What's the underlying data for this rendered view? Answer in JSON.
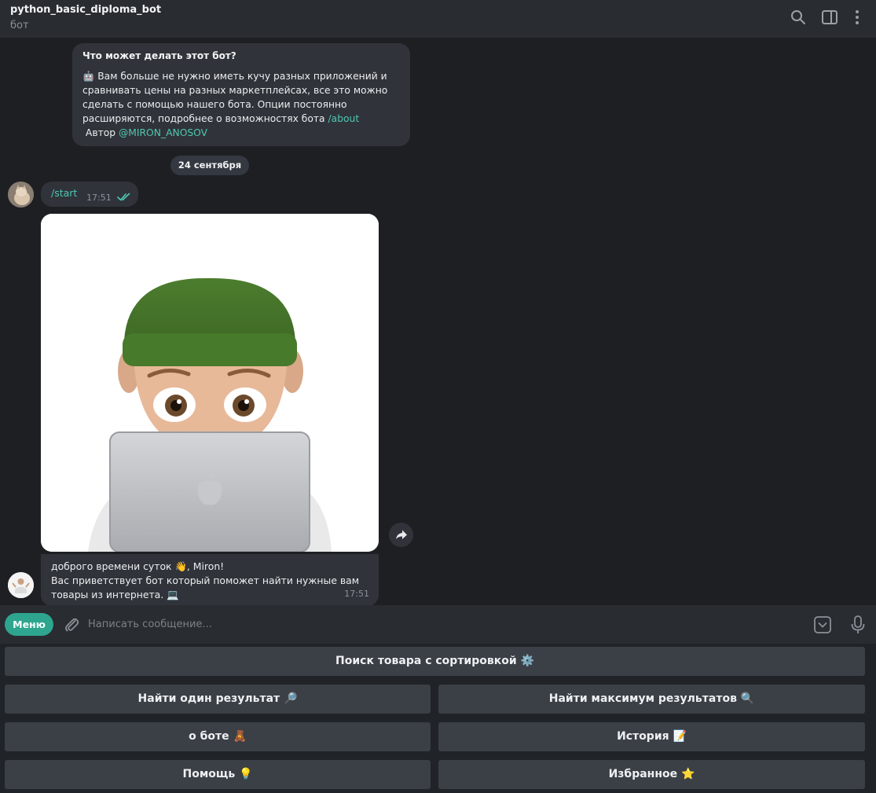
{
  "header": {
    "title": "python_basic_diploma_bot",
    "subtitle": "бот",
    "icons": [
      "search-icon",
      "sidebar-toggle-icon",
      "more-vertical-icon"
    ]
  },
  "chat": {
    "intro": {
      "title": "Что может делать этот бот?",
      "body": "🤖 Вам больше не нужно иметь кучу разных приложений и сравнивать цены на разных маркетплейсах, все это можно сделать  с помощью нашего бота.  Опции постоянно расширяются, подробнее о возможностях бота ",
      "about_link": "/about",
      "author_label": " Автор ",
      "author_link": "@MIRON_ANOSOV"
    },
    "date_separator": "24 сентября",
    "start_message": {
      "text": "/start",
      "time": "17:51",
      "status": "read"
    },
    "bot_reply": {
      "line1": "доброго времени суток 👋, Miron!",
      "line2": "Вас приветствует бот который поможет найти нужные вам товары из интернета. 💻",
      "time": "17:51"
    }
  },
  "composer": {
    "menu_label": "Меню",
    "placeholder": "Написать сообщение..."
  },
  "keyboard": {
    "rows": [
      [
        "Поиск товара с сортировкой ⚙️"
      ],
      [
        "Найти один результат 🔎",
        "Найти максимум результатов 🔍"
      ],
      [
        "о боте 🧸",
        "История 📝"
      ],
      [
        "Помощь 💡",
        "Избранное ⭐"
      ]
    ]
  },
  "colors": {
    "accent": "#2ea58f",
    "link": "#4fc7b3",
    "bubble": "#30343a",
    "background": "#1d1f23"
  }
}
